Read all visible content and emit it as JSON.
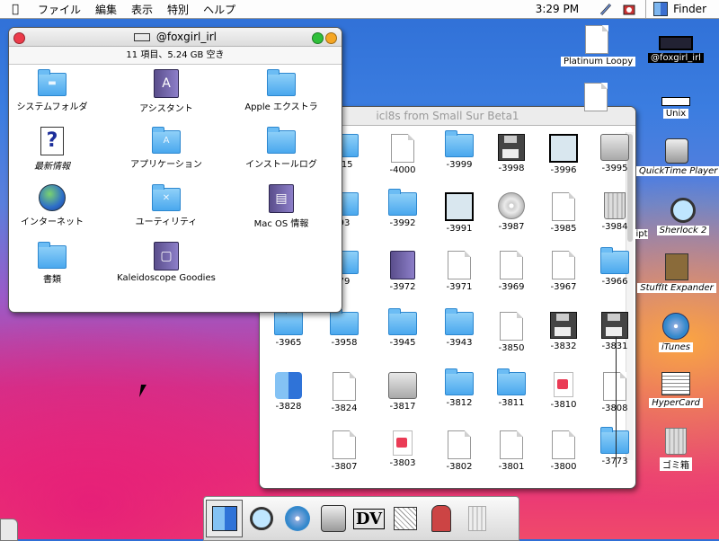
{
  "menubar": {
    "items": [
      "ファイル",
      "編集",
      "表示",
      "特別",
      "ヘルプ"
    ],
    "clock": "3:29 PM",
    "app": "Finder"
  },
  "win_main": {
    "title": "@foxgirl_irl",
    "status": "11 項目、5.24 GB 空き",
    "items": [
      {
        "label": "システムフォルダ",
        "icon": "system-folder-icon"
      },
      {
        "label": "アシスタント",
        "icon": "book-icon"
      },
      {
        "label": "Apple エクストラ",
        "icon": "folder-icon"
      },
      {
        "label": "最新情報",
        "icon": "help-document-icon"
      },
      {
        "label": "アプリケーション",
        "icon": "applications-folder-icon"
      },
      {
        "label": "インストールログ",
        "icon": "folder-icon"
      },
      {
        "label": "インターネット",
        "icon": "internet-icon"
      },
      {
        "label": "ユーティリティ",
        "icon": "utilities-folder-icon"
      },
      {
        "label": "Mac OS 情報",
        "icon": "book-icon"
      },
      {
        "label": "書類",
        "icon": "folder-icon"
      },
      {
        "label": "Kaleidoscope Goodies",
        "icon": "book-icon"
      }
    ]
  },
  "win_icons": {
    "title": "icl8s from Small Sur Beta1",
    "labels": [
      "415",
      "-4000",
      "-3999",
      "-3998",
      "-3996",
      "-3995",
      "93",
      "-3992",
      "-3991",
      "-3987",
      "-3985",
      "-3984",
      "79",
      "-3972",
      "-3971",
      "-3969",
      "-3967",
      "-3966",
      "-3965",
      "-3958",
      "-3945",
      "-3943",
      "-3850",
      "-3832",
      "-3831",
      "-3828",
      "-3824",
      "-3817",
      "-3812",
      "-3811",
      "-3810",
      "-3808",
      "-3807",
      "-3803",
      "-3802",
      "-3801",
      "-3800",
      "-3773"
    ]
  },
  "desktop": {
    "icons": [
      "Platinum Loopy",
      "@foxgirl_irl",
      "Unix",
      "QuickTime Player",
      "ipt",
      "Sherlock 2",
      "StuffIt Expander",
      "iTunes",
      "HyperCard",
      "ゴミ箱"
    ]
  },
  "dock": {
    "items": [
      "finder-icon",
      "sherlock-icon",
      "itunes-icon",
      "quicktime-icon",
      "dvd-player-icon",
      "script-editor-icon",
      "stuffit-icon",
      "trash-icon"
    ]
  },
  "colors": {
    "accent": "#4aa8ee",
    "close": "#ec3b4a",
    "zoom": "#2fbf3a",
    "collapse": "#f5a623"
  }
}
